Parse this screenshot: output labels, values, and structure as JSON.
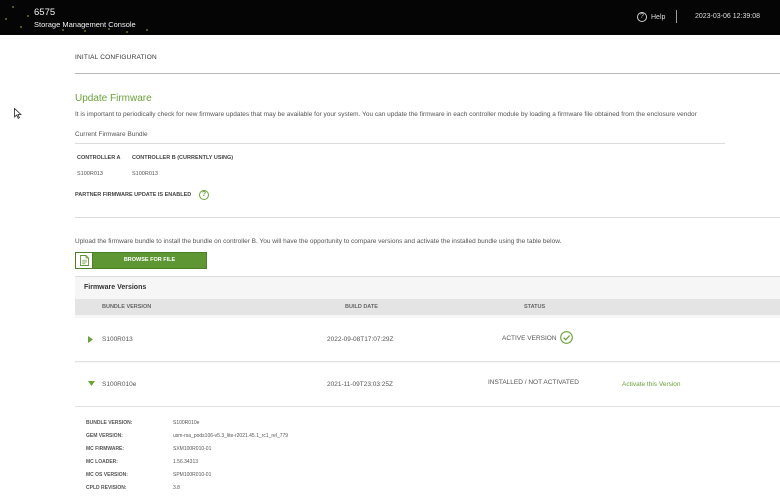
{
  "header": {
    "app_id": "6575",
    "app_name": "Storage Management Console",
    "help_label": "Help",
    "datetime": "2023-03-06 12:39:08"
  },
  "breadcrumb": "INITIAL CONFIGURATION",
  "page": {
    "title": "Update Firmware",
    "intro": "It is important to periodically check for new firmware updates that may be available for your system. You can update the firmware in each controller module by loading a firmware file obtained from the enclosure vendor",
    "bundle_heading": "Current Firmware Bundle"
  },
  "controllers": {
    "a": {
      "label": "CONTROLLER A",
      "value": "S100R013"
    },
    "b": {
      "label": "CONTROLLER B (CURRENTLY USING)",
      "value": "S100R013"
    }
  },
  "partner_update": {
    "label": "PARTNER FIRMWARE UPDATE IS ENABLED",
    "help_glyph": "?"
  },
  "upload": {
    "text": "Upload the firmware bundle to install the bundle on controller B. You will have the opportunity to compare versions and activate the installed bundle using the table below.",
    "button_label": "BROWSE FOR FILE"
  },
  "firmware_versions": {
    "title": "Firmware Versions",
    "columns": {
      "bundle_version": "BUNDLE VERSION",
      "build_date": "BUILD DATE",
      "status": "STATUS"
    },
    "rows": [
      {
        "bundle_version": "S100R013",
        "build_date": "2022-09-08T17:07:29Z",
        "status": "ACTIVE VERSION",
        "expanded": false
      },
      {
        "bundle_version": "S100R010e",
        "build_date": "2021-11-09T23:03:25Z",
        "status": "INSTALLED / NOT ACTIVATED",
        "action": "Activate this Version",
        "expanded": true
      }
    ],
    "details": [
      {
        "label": "BUNDLE VERSION:",
        "value": "S100R010e"
      },
      {
        "label": "GEM VERSION:",
        "value": "usm-rsa_pods106-v5.3_lite-r2021.45.1_rc1_rel_779"
      },
      {
        "label": "MC FIRMWARE:",
        "value": "SXM100R010-01"
      },
      {
        "label": "MC LOADER:",
        "value": "1.56.34313"
      },
      {
        "label": "MC OS VERSION:",
        "value": "SPM100R010-01"
      },
      {
        "label": "CPLD REVISION:",
        "value": "3.8"
      }
    ]
  },
  "colors": {
    "header_bg": "#050505",
    "accent_green": "#6aa13a",
    "button_green": "#5f9634",
    "panel_bg": "#f6f6f6",
    "column_header_bg": "#e4e4e4"
  },
  "icons": [
    "help-circle-icon",
    "cursor-arrow-icon",
    "question-circle-icon",
    "file-upload-icon",
    "expand-arrow-icon",
    "collapse-arrow-icon",
    "checkmark-circle-icon"
  ]
}
